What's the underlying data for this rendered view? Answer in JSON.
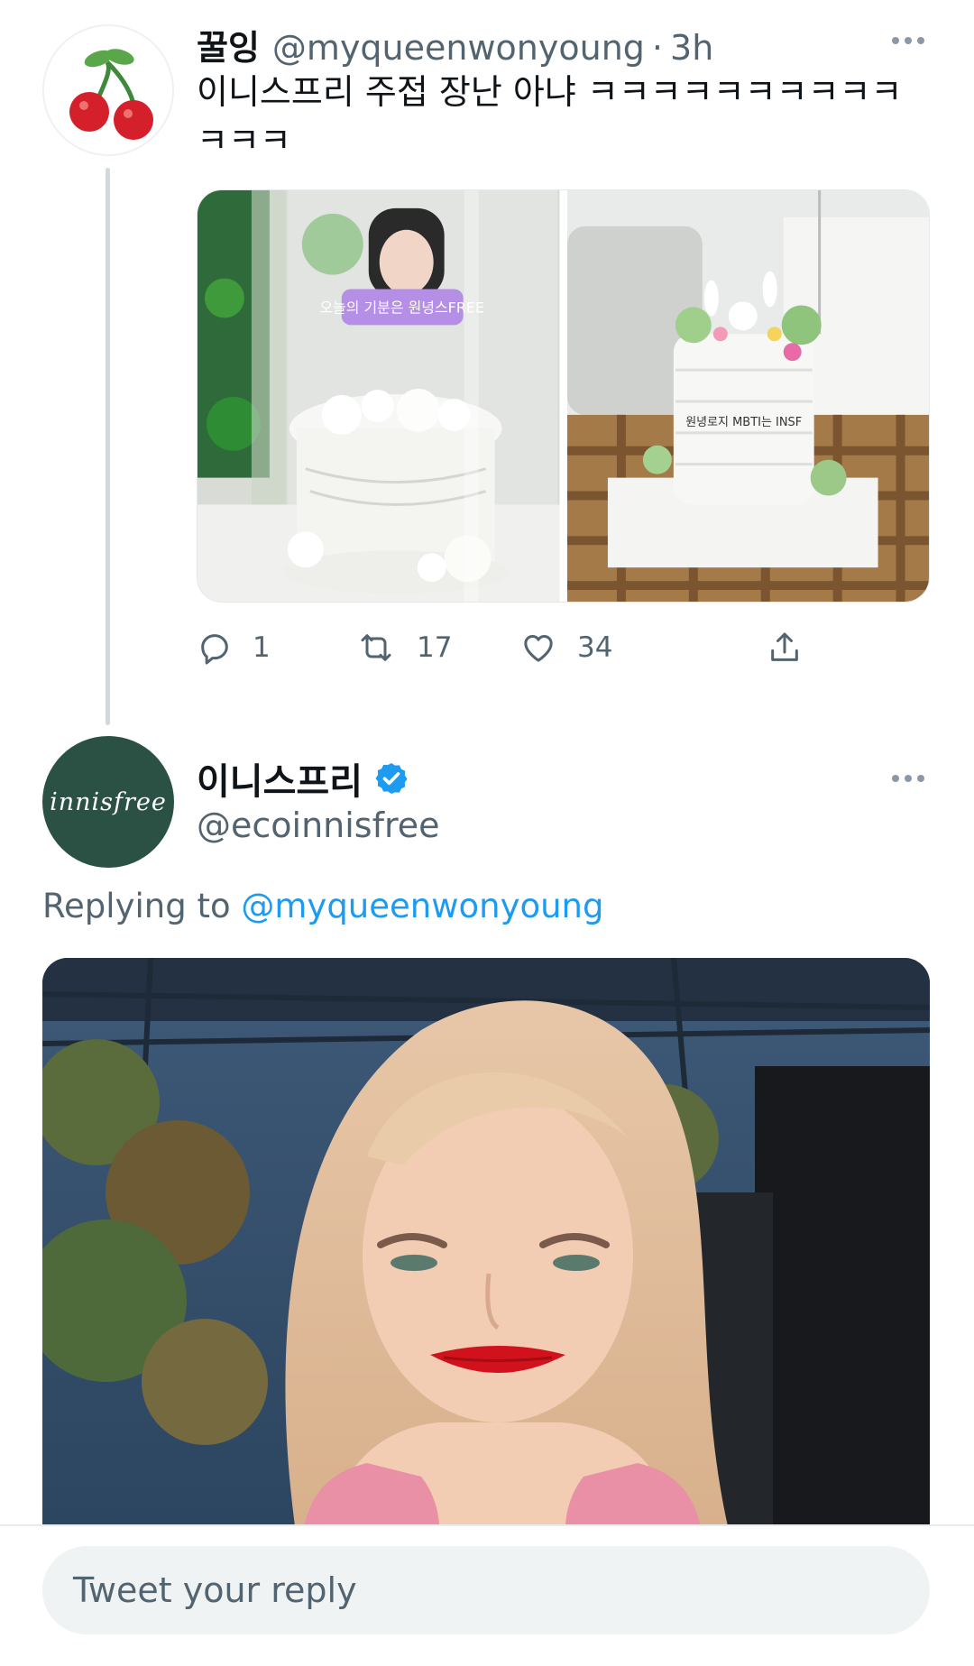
{
  "tweet1": {
    "author_name": "꿀잉",
    "handle": "@myqueenwonyoung",
    "separator": "·",
    "time": "3h",
    "text": "이니스프리 주접 장난 아냐 ㅋㅋㅋㅋㅋㅋㅋㅋㅋㅋㅋㅋㅋ",
    "avatar_icon": "cherry-icon",
    "media": [
      {
        "description": "white floral cake with photo topper in acrylic box",
        "topper_text": "오늘의 기분은 원녕스FREE"
      },
      {
        "description": "white cake with bunny figures and flowers on wooden tray",
        "cake_text": "원녕로지 MBTI는 INSF"
      }
    ],
    "counts": {
      "reply": "1",
      "retweet": "17",
      "like": "34"
    },
    "icons": {
      "reply": "reply-icon",
      "retweet": "retweet-icon",
      "like": "heart-icon",
      "share": "share-icon",
      "more": "more-icon"
    }
  },
  "tweet2": {
    "author_name": "이니스프리",
    "handle": "@ecoinnisfree",
    "avatar_text": "innisfree",
    "verified": true,
    "verified_icon": "verified-badge-icon",
    "replying_prefix": "Replying to",
    "replying_handle": "@myqueenwonyoung",
    "gif_description": "smiling blonde woman with red lipstick, hands under chin"
  },
  "reply_bar": {
    "placeholder": "Tweet your reply"
  },
  "colors": {
    "accent": "#1d9bf0",
    "text_primary": "#0f1419",
    "text_secondary": "#536471",
    "brand_green": "#2b5145",
    "thread_line": "#cfd9de",
    "input_bg": "#eff3f4"
  }
}
